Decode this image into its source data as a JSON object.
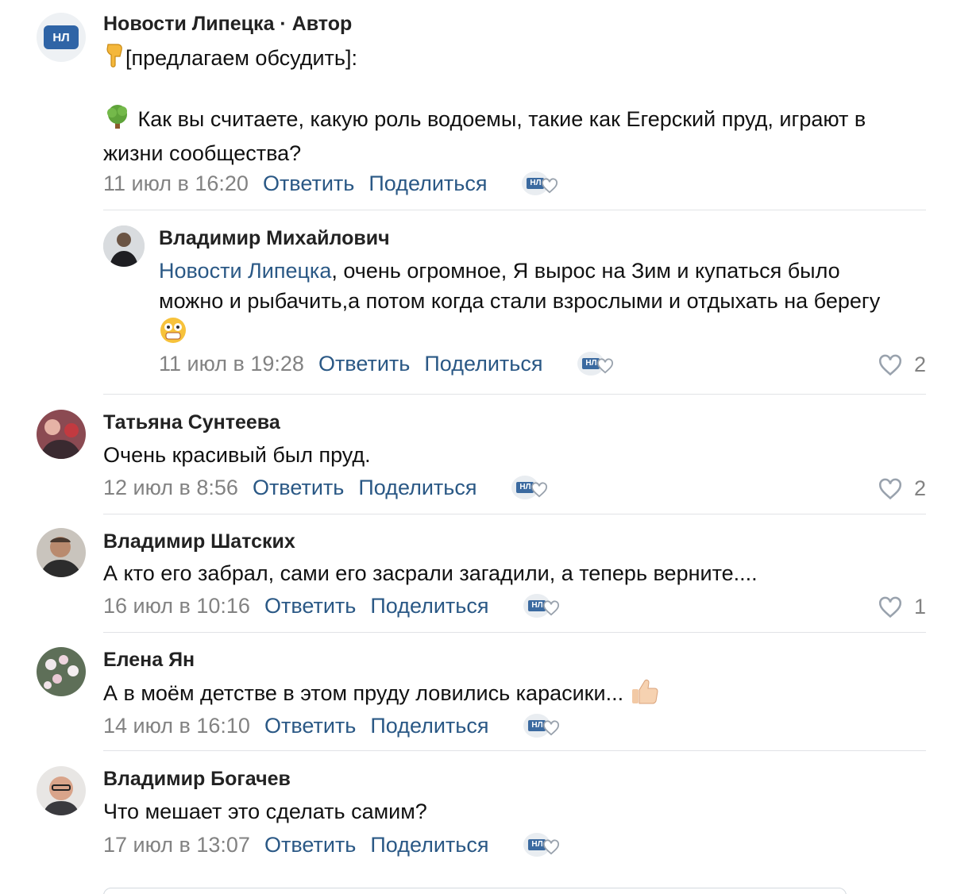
{
  "comments": [
    {
      "author": "Новости Липецка · Автор",
      "avatar_text": "НЛ",
      "line1": "[предлагаем обсудить]:",
      "line2": "Как вы считаете, какую роль водоемы, такие как Егерский пруд, играют в жизни сообщества?",
      "date": "11 июл в 16:20",
      "reply": "Ответить",
      "share": "Поделиться"
    },
    {
      "author": "Владимир Михайлович",
      "mention": "Новости Липецка",
      "text": ", очень огромное, Я вырос на Зим и купаться было можно и рыбачить,а потом когда стали взрослыми и отдыхать на берегу",
      "date": "11 июл в 19:28",
      "reply": "Ответить",
      "share": "Поделиться",
      "likes": "2"
    },
    {
      "author": "Татьяна Сунтеева",
      "text": "Очень красивый был пруд.",
      "date": "12 июл в 8:56",
      "reply": "Ответить",
      "share": "Поделиться",
      "likes": "2"
    },
    {
      "author": "Владимир Шатских",
      "text": "А кто его забрал, сами его засрали загадили, а теперь верните....",
      "date": "16 июл в 10:16",
      "reply": "Ответить",
      "share": "Поделиться",
      "likes": "1"
    },
    {
      "author": "Елена Ян",
      "text": "А в моём детстве в этом пруду ловились карасики...",
      "date": "14 июл в 16:10",
      "reply": "Ответить",
      "share": "Поделиться"
    },
    {
      "author": "Владимир Богачев",
      "text": "Что мешает это сделать самим?",
      "date": "17 июл в 13:07",
      "reply": "Ответить",
      "share": "Поделиться"
    }
  ],
  "colors": {
    "link": "#2a5885",
    "meta": "#828282",
    "divider": "#e1e3e6",
    "badge": "#3b6aa0"
  },
  "icons": [
    "finger-down-emoji",
    "tree-emoji",
    "grinning-face-emoji",
    "thumbs-up-emoji",
    "heart-icon",
    "group-avatar-badge"
  ]
}
